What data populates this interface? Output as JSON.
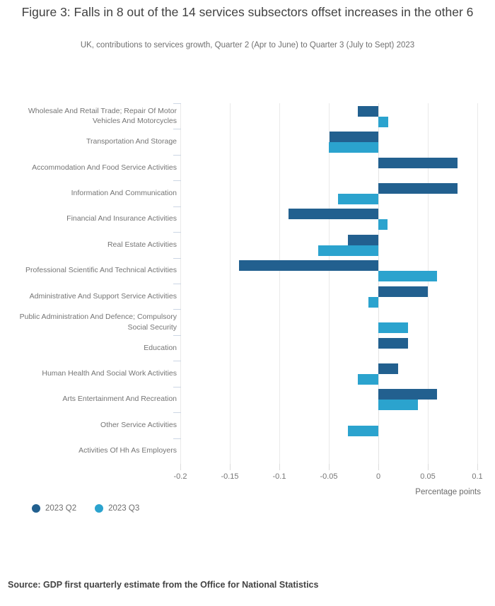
{
  "chart_data": {
    "type": "bar",
    "orientation": "horizontal",
    "title": "Figure 3: Falls in 8 out of the 14 services subsectors offset increases in the other 6",
    "subtitle": "UK, contributions to services growth, Quarter 2 (Apr to June) to Quarter 3 (July to Sept) 2023",
    "xlabel": "Percentage points",
    "ylabel": "",
    "xlim": [
      -0.2,
      0.1
    ],
    "xticks": [
      "-0.2",
      "-0.15",
      "-0.1",
      "-0.05",
      "0",
      "0.05",
      "0.1"
    ],
    "xtick_values": [
      -0.2,
      -0.15,
      -0.1,
      -0.05,
      0,
      0.05,
      0.1
    ],
    "grid": true,
    "legend_position": "bottom-left",
    "categories": [
      "Wholesale And Retail Trade; Repair Of Motor Vehicles And Motorcycles",
      "Transportation And Storage",
      "Accommodation And Food Service Activities",
      "Information And Communication",
      "Financial And Insurance Activities",
      "Real Estate Activities",
      "Professional Scientific And Technical Activities",
      "Administrative And Support Service Activities",
      "Public Administration And Defence; Compulsory Social Security",
      "Education",
      "Human Health And Social Work Activities",
      "Arts Entertainment And Recreation",
      "Other Service Activities",
      "Activities Of Hh As Employers"
    ],
    "series": [
      {
        "name": "2023 Q2",
        "color": "#22608f",
        "values": [
          -0.021,
          -0.049,
          0.08,
          0.08,
          -0.091,
          -0.031,
          -0.141,
          0.05,
          0.0,
          0.03,
          0.02,
          0.059,
          0.0,
          0.0
        ]
      },
      {
        "name": "2023 Q3",
        "color": "#2ba3ce",
        "values": [
          0.01,
          -0.05,
          0.0,
          -0.041,
          0.009,
          -0.061,
          0.059,
          -0.01,
          0.03,
          0.0,
          -0.021,
          0.04,
          -0.031,
          0.0
        ]
      }
    ]
  },
  "legend": [
    {
      "label": "2023 Q2",
      "color": "#22608f",
      "marker": "circle-marker"
    },
    {
      "label": "2023 Q3",
      "color": "#2ba3ce",
      "marker": "circle-marker"
    }
  ],
  "source": {
    "text": "Source: GDP first quarterly estimate from the Office for National Statistics"
  }
}
